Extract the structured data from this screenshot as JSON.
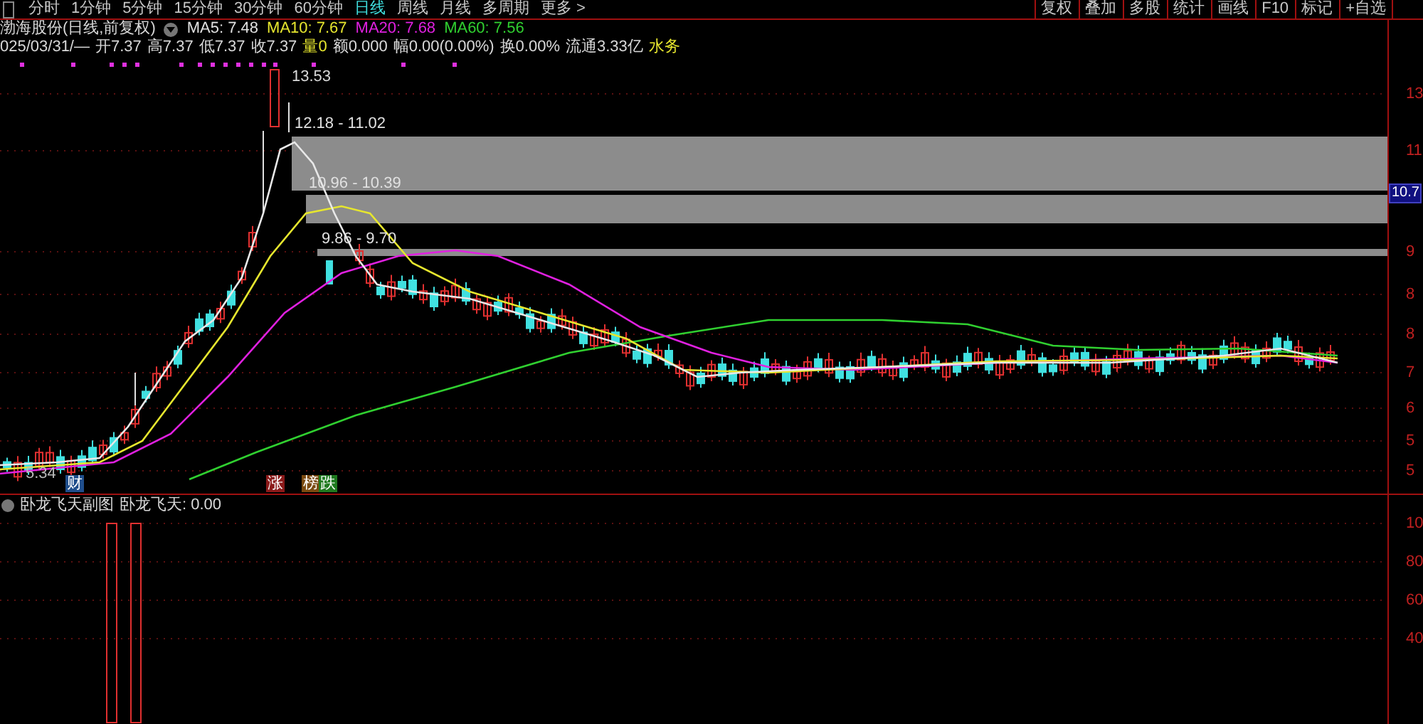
{
  "toolbar": {
    "periods": [
      {
        "label": "分时",
        "selected": false
      },
      {
        "label": "1分钟",
        "selected": false
      },
      {
        "label": "5分钟",
        "selected": false
      },
      {
        "label": "15分钟",
        "selected": false
      },
      {
        "label": "30分钟",
        "selected": false
      },
      {
        "label": "60分钟",
        "selected": false
      },
      {
        "label": "日线",
        "selected": true
      },
      {
        "label": "周线",
        "selected": false
      },
      {
        "label": "月线",
        "selected": false
      },
      {
        "label": "多周期",
        "selected": false
      },
      {
        "label": "更多 >",
        "selected": false
      }
    ],
    "buttons": [
      "复权",
      "叠加",
      "多股",
      "统计",
      "画线",
      "F10",
      "标记",
      "+自选"
    ]
  },
  "header": {
    "title": "渤海股份(日线,前复权)",
    "moving_averages": [
      {
        "label": "MA5: 7.48",
        "color": "#e0e0e0"
      },
      {
        "label": "MA10: 7.67",
        "color": "#e6e62e"
      },
      {
        "label": "MA20: 7.68",
        "color": "#e020e0"
      },
      {
        "label": "MA60: 7.56",
        "color": "#30d030"
      }
    ]
  },
  "quote": {
    "date": "025/03/31/—",
    "fields": [
      {
        "text": "开7.37",
        "color": "#d8d8d8"
      },
      {
        "text": "高7.37",
        "color": "#d8d8d8"
      },
      {
        "text": "低7.37",
        "color": "#d8d8d8"
      },
      {
        "text": "收7.37",
        "color": "#d8d8d8"
      },
      {
        "text": "量0",
        "color": "#e6e62e"
      },
      {
        "text": "额0.000",
        "color": "#d8d8d8"
      },
      {
        "text": "幅0.00(0.00%)",
        "color": "#d8d8d8"
      },
      {
        "text": "换0.00%",
        "color": "#d8d8d8"
      },
      {
        "text": "流通3.33亿",
        "color": "#d8d8d8"
      },
      {
        "text": "水务",
        "color": "#e6e62e"
      }
    ]
  },
  "chart": {
    "high_label": "13.53",
    "low_label": "5.34",
    "zones": [
      {
        "label": "12.18 - 11.02"
      },
      {
        "label": "10.96 - 10.39"
      },
      {
        "label": "9.86 - 9.70"
      }
    ],
    "markers": [
      {
        "text": "财",
        "color": "#1f4e8c"
      },
      {
        "text": "涨",
        "color": "#8b1a1a"
      },
      {
        "text": "榜",
        "color": "#7a4a10"
      },
      {
        "text": "跌",
        "color": "#1f7a1f"
      }
    ],
    "axis_labels": [
      "13",
      "11",
      "9",
      "8",
      "8",
      "7",
      "6",
      "5",
      "5"
    ],
    "current_price": "10.7"
  },
  "subchart": {
    "title": "卧龙飞天副图",
    "reading": "卧龙飞天: 0.00",
    "axis_labels": [
      "10",
      "80",
      "60",
      "40"
    ]
  }
}
